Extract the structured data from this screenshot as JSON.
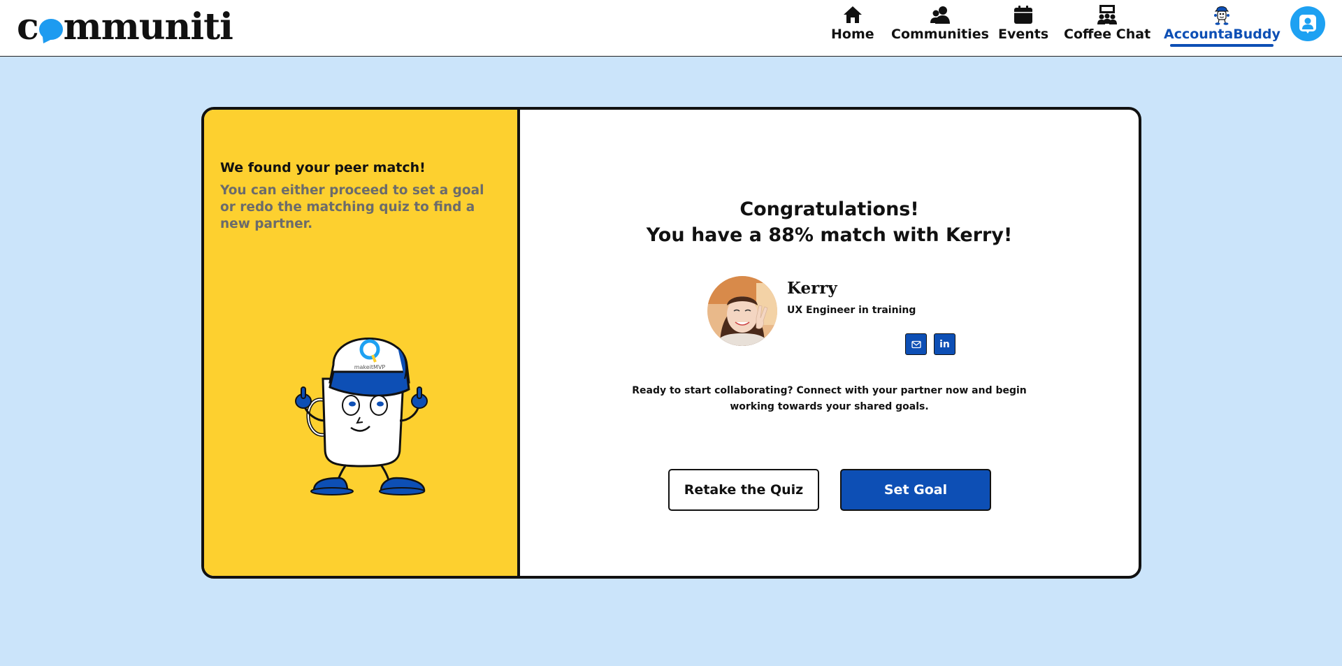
{
  "header": {
    "logo_text": "communiti",
    "nav": [
      {
        "label": "Home",
        "icon": "home-icon"
      },
      {
        "label": "Communities",
        "icon": "communities-icon"
      },
      {
        "label": "Events",
        "icon": "calendar-icon"
      },
      {
        "label": "Coffee Chat",
        "icon": "coffee-chat-icon"
      },
      {
        "label": "AccountaBuddy",
        "icon": "accountabuddy-mascot-icon",
        "active": true
      }
    ],
    "profile_icon": "user-profile-icon"
  },
  "left_panel": {
    "title": "We found your peer match!",
    "description": "You can either proceed to set a goal or redo the matching quiz to find a new partner.",
    "mascot": "mug-mascot-illustration",
    "mascot_cap_text": "makeitMVP"
  },
  "match": {
    "congrats_line1": "Congratulations!",
    "congrats_line2": "You have a 88% match with Kerry!",
    "name": "Kerry",
    "role": "UX Engineer in training",
    "photo": "kerry-profile-photo",
    "social": [
      {
        "icon": "email-icon"
      },
      {
        "icon": "linkedin-icon",
        "text": "in"
      }
    ],
    "ready_text": "Ready to start collaborating? Connect with your partner now and begin working towards your shared goals."
  },
  "actions": {
    "retake_label": "Retake the Quiz",
    "set_goal_label": "Set Goal"
  },
  "colors": {
    "background": "#cbe4fa",
    "panel_yellow": "#fdd02f",
    "accent_blue": "#0d4fb5",
    "logo_bubble": "#1d9bf0"
  }
}
